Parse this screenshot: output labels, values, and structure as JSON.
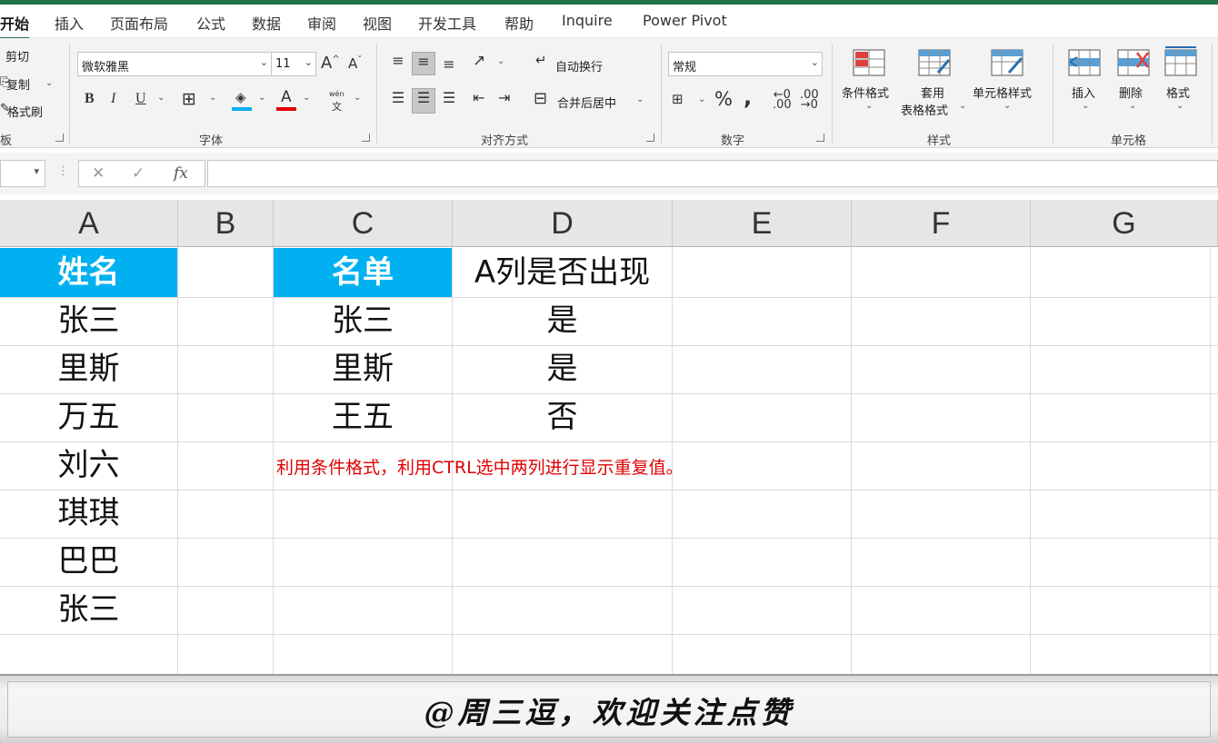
{
  "tabs": [
    "开始",
    "插入",
    "页面布局",
    "公式",
    "数据",
    "审阅",
    "视图",
    "开发工具",
    "帮助",
    "Inquire",
    "Power Pivot"
  ],
  "clipboard": {
    "cut": "剪切",
    "copy": "复制",
    "painter": "格式刷",
    "label": "板"
  },
  "font": {
    "name": "微软雅黑",
    "size": "11",
    "bold": "B",
    "italic": "I",
    "underline": "U",
    "grow": "A",
    "shrink": "A",
    "label": "字体",
    "pinyin_top": "wén",
    "pinyin_bottom": "文"
  },
  "alignment": {
    "wrap": "自动换行",
    "merge": "合并后居中",
    "label": "对齐方式"
  },
  "number": {
    "format": "常规",
    "percent": "%",
    "comma": ",",
    "label": "数字"
  },
  "styles": {
    "conditional": "条件格式",
    "table_line1": "套用",
    "table_line2": "表格格式",
    "cell_styles": "单元格样式",
    "label": "样式"
  },
  "cells": {
    "insert": "插入",
    "delete": "删除",
    "format": "格式",
    "label": "单元格"
  },
  "formula_bar": {
    "cancel": "✕",
    "enter": "✓",
    "fx": "fx",
    "value": ""
  },
  "columns": [
    "A",
    "B",
    "C",
    "D",
    "E",
    "F",
    "G"
  ],
  "sheet": {
    "col_a_header": "姓名",
    "col_a": [
      "张三",
      "里斯",
      "万五",
      "刘六",
      "琪琪",
      "巴巴",
      "张三"
    ],
    "col_c_header": "名单",
    "col_c": [
      "张三",
      "里斯",
      "王五"
    ],
    "col_d_header": "A列是否出现",
    "col_d": [
      "是",
      "是",
      "否"
    ],
    "note": "利用条件格式，利用CTRL选中两列进行显示重复值。"
  },
  "watermark": "@周三逗，欢迎关注点赞",
  "colors": {
    "accent": "#217346",
    "header_fill": "#00b0f0",
    "note": "#e00000"
  }
}
